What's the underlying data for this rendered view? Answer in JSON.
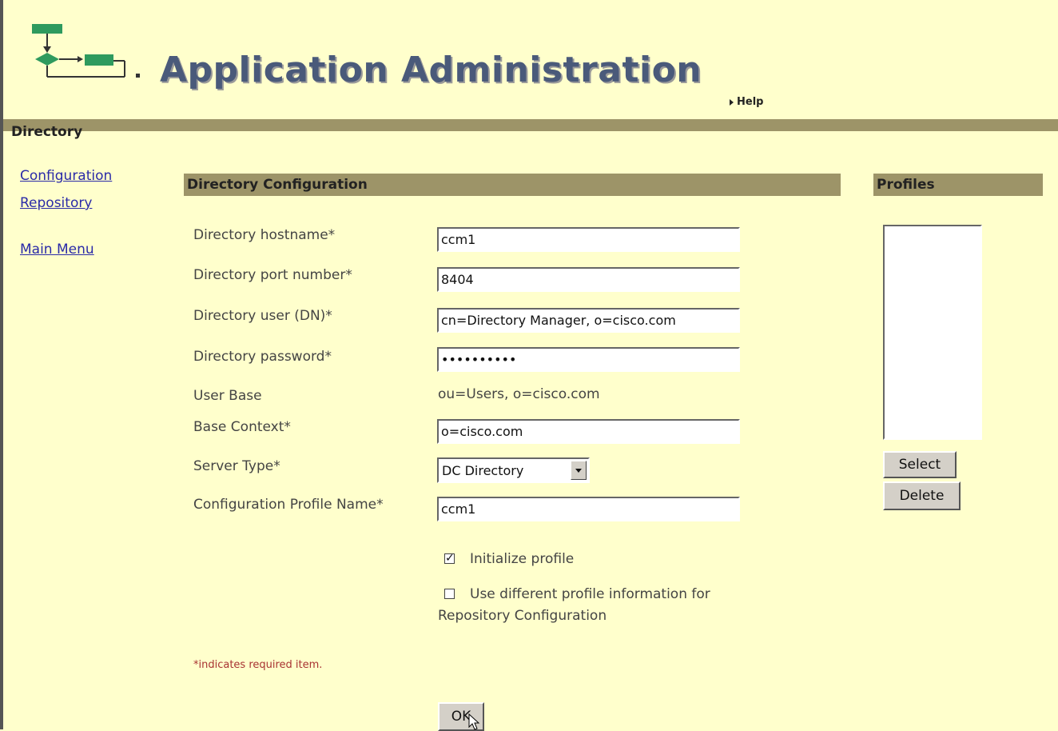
{
  "header": {
    "app_title": "Application Administration",
    "help_label": "Help"
  },
  "section": {
    "title": "Directory"
  },
  "sidebar": {
    "links": [
      {
        "label": "Configuration"
      },
      {
        "label": "Repository"
      },
      {
        "label": "Main Menu"
      }
    ]
  },
  "directory_config": {
    "heading": "Directory Configuration",
    "fields": {
      "hostname": {
        "label": "Directory hostname*",
        "value": "ccm1"
      },
      "port": {
        "label": "Directory port number*",
        "value": "8404"
      },
      "user_dn": {
        "label": "Directory user (DN)*",
        "value": "cn=Directory Manager, o=cisco.com"
      },
      "password": {
        "label": "Directory password*",
        "value": "**********"
      },
      "user_base": {
        "label": "User Base",
        "value": "ou=Users, o=cisco.com"
      },
      "base_context": {
        "label": "Base Context*",
        "value": "o=cisco.com"
      },
      "server_type": {
        "label": "Server Type*",
        "value": "DC Directory"
      },
      "profile_name": {
        "label": "Configuration Profile Name*",
        "value": "ccm1"
      }
    },
    "initialize_profile": {
      "label": "Initialize profile",
      "checked": true
    },
    "different_profile": {
      "label": "Use different profile information for Repository Configuration",
      "checked": false
    },
    "required_note": "*indicates required item.",
    "ok_label": "OK"
  },
  "profiles": {
    "heading": "Profiles",
    "select_label": "Select",
    "delete_label": "Delete"
  },
  "colors": {
    "background": "#ffffcc",
    "bar": "#9d9468",
    "link": "#2a2aa8",
    "required_note": "#a83232",
    "logo_green": "#2e9a5e"
  }
}
